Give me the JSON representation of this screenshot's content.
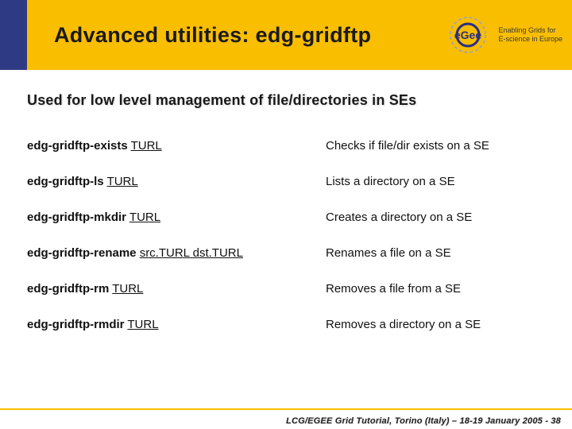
{
  "header": {
    "title": "Advanced utilities:  edg-gridftp"
  },
  "brand": {
    "name": "eGee",
    "tagline1": "Enabling Grids for",
    "tagline2": "E-science in Europe"
  },
  "lead": "Used for low level management of file/directories in SEs",
  "commands": [
    {
      "cmd": "edg-gridftp-exists",
      "args": "TURL",
      "desc": "Checks if file/dir exists on a SE"
    },
    {
      "cmd": "edg-gridftp-ls",
      "args": "TURL",
      "desc": "Lists a directory on a SE"
    },
    {
      "cmd": "edg-gridftp-mkdir",
      "args": "TURL",
      "desc": "Creates a directory on a SE"
    },
    {
      "cmd": "edg-gridftp-rename",
      "args": "src.TURL dst.TURL",
      "desc": "Renames a file on a SE"
    },
    {
      "cmd": "edg-gridftp-rm",
      "args": "TURL",
      "desc": "Removes a file from a SE"
    },
    {
      "cmd": "edg-gridftp-rmdir",
      "args": "TURL",
      "desc": "Removes a directory on a SE"
    }
  ],
  "footer": "LCG/EGEE Grid Tutorial, Torino (Italy) – 18-19 January 2005 - 38"
}
